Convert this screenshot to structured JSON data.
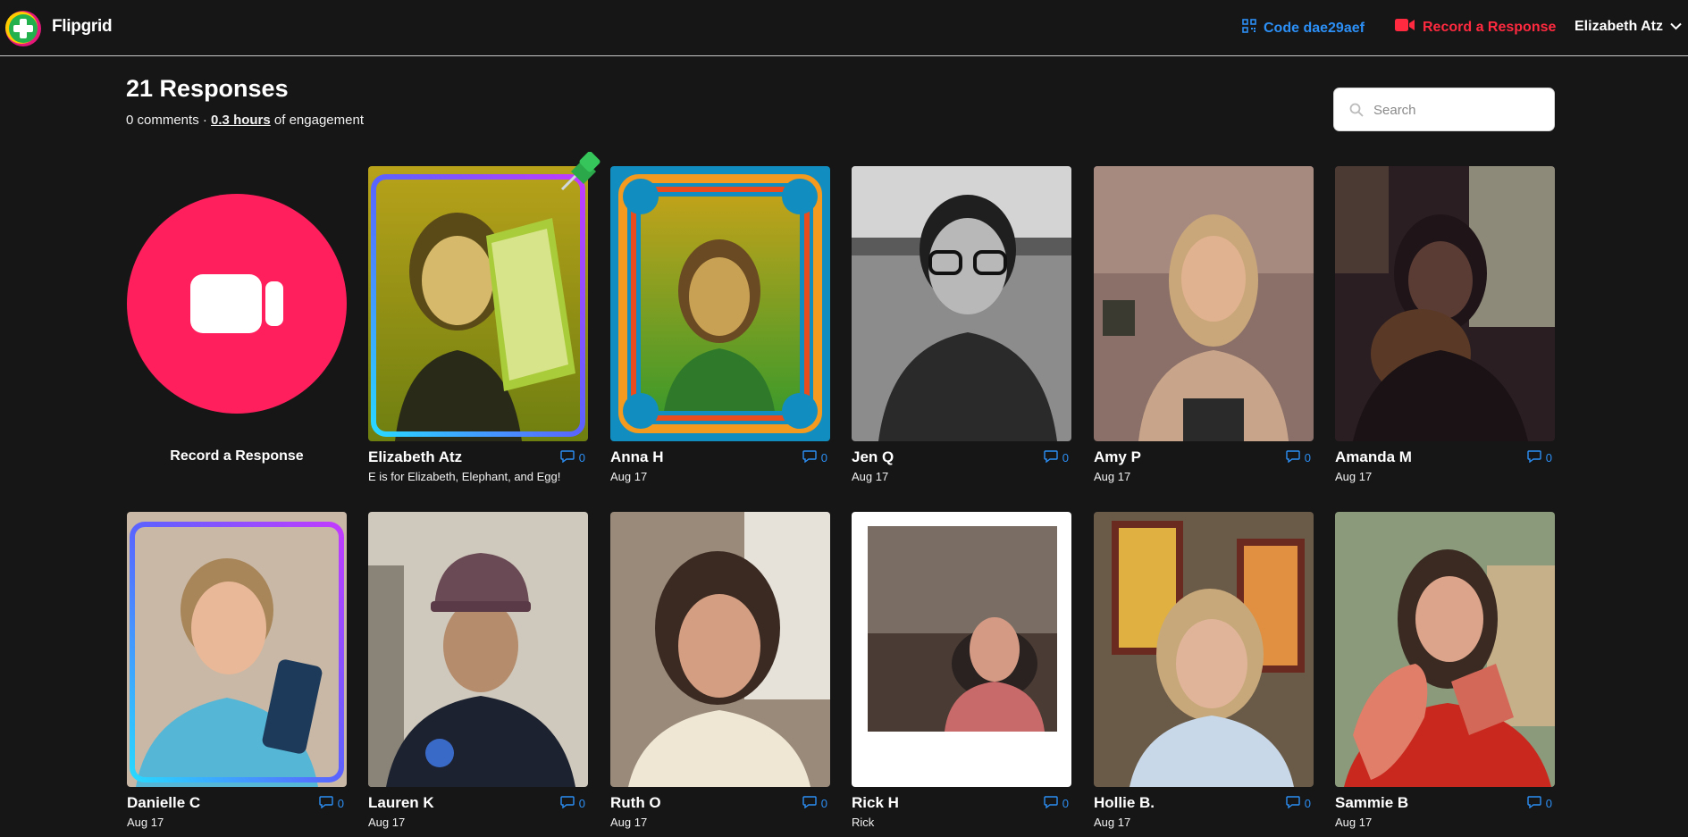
{
  "header": {
    "brand": "Flipgrid",
    "code_label": "Code dae29aef",
    "record_label": "Record a Response",
    "user_name": "Elizabeth Atz"
  },
  "summary": {
    "title": "21 Responses",
    "comments": "0 comments",
    "separator": "·",
    "hours": "0.3 hours",
    "engagement_suffix": "of engagement"
  },
  "search": {
    "placeholder": "Search"
  },
  "record_tile": {
    "label": "Record a Response"
  },
  "colors": {
    "background": "#161616",
    "accent_blue": "#2c8ff5",
    "record_red": "#ff2a3f",
    "record_circle": "#ff1f5c"
  },
  "responses": [
    {
      "name": "Elizabeth Atz",
      "subtitle": "E is for Elizabeth, Elephant, and Egg!",
      "comments": "0",
      "pinned": true,
      "frame": "neon"
    },
    {
      "name": "Anna H",
      "subtitle": "Aug 17",
      "comments": "0",
      "frame": "retro"
    },
    {
      "name": "Jen Q",
      "subtitle": "Aug 17",
      "comments": "0",
      "frame": "grayscale"
    },
    {
      "name": "Amy P",
      "subtitle": "Aug 17",
      "comments": "0",
      "frame": "none"
    },
    {
      "name": "Amanda M",
      "subtitle": "Aug 17",
      "comments": "0",
      "frame": "none"
    },
    {
      "name": "Danielle C",
      "subtitle": "Aug 17",
      "comments": "0",
      "frame": "neon"
    },
    {
      "name": "Lauren K",
      "subtitle": "Aug 17",
      "comments": "0",
      "frame": "none"
    },
    {
      "name": "Ruth O",
      "subtitle": "Aug 17",
      "comments": "0",
      "frame": "none"
    },
    {
      "name": "Rick H",
      "subtitle": "Rick",
      "comments": "0",
      "frame": "polaroid"
    },
    {
      "name": "Hollie B.",
      "subtitle": "Aug 17",
      "comments": "0",
      "frame": "none"
    },
    {
      "name": "Sammie B",
      "subtitle": "Aug 17",
      "comments": "0",
      "frame": "none"
    }
  ]
}
